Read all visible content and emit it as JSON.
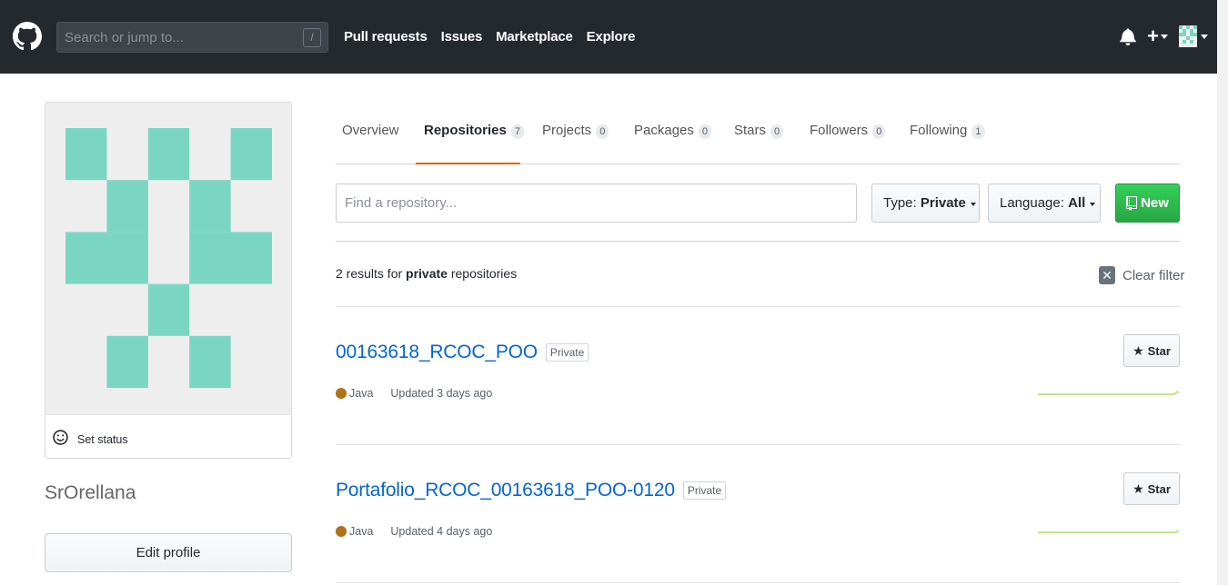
{
  "header": {
    "search_placeholder": "Search or jump to...",
    "search_shortcut": "/",
    "nav": [
      "Pull requests",
      "Issues",
      "Marketplace",
      "Explore"
    ],
    "plus_label": "+"
  },
  "profile": {
    "set_status": "Set status",
    "username": "SrOrellana",
    "edit_profile": "Edit profile",
    "identicon_color": "#7bd6c1"
  },
  "tabs": [
    {
      "label": "Overview",
      "count": ""
    },
    {
      "label": "Repositories",
      "count": "7"
    },
    {
      "label": "Projects",
      "count": "0"
    },
    {
      "label": "Packages",
      "count": "0"
    },
    {
      "label": "Stars",
      "count": "0"
    },
    {
      "label": "Followers",
      "count": "0"
    },
    {
      "label": "Following",
      "count": "1"
    }
  ],
  "filter": {
    "find_placeholder": "Find a repository...",
    "type_label": "Type: ",
    "type_value": "Private",
    "language_label": "Language: ",
    "language_value": "All",
    "new_label": "New"
  },
  "results": {
    "count_text": "2 results for ",
    "bold_text": "private",
    "tail_text": " repositories",
    "clear_label": "Clear filter"
  },
  "repos": [
    {
      "name": "00163618_RCOC_POO",
      "badge": "Private",
      "language": "Java",
      "language_color": "#b07219",
      "updated": "Updated 3 days ago",
      "star_label": "Star"
    },
    {
      "name": "Portafolio_RCOC_00163618_POO-0120",
      "badge": "Private",
      "language": "Java",
      "language_color": "#b07219",
      "updated": "Updated 4 days ago",
      "star_label": "Star"
    }
  ]
}
